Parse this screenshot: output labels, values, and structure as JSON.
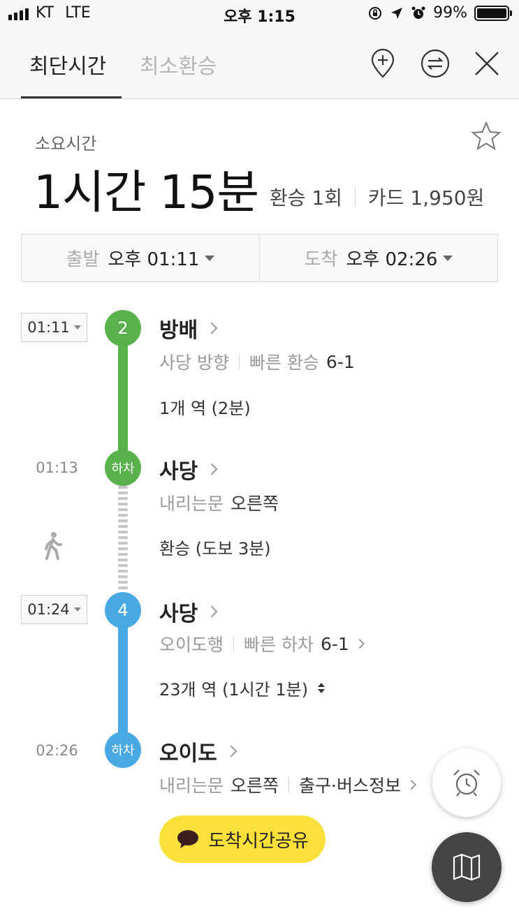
{
  "status_bar": {
    "carrier": "KT",
    "network": "LTE",
    "time": "오후 1:15",
    "battery": "99%",
    "battery_level": 0.99
  },
  "header": {
    "tabs": [
      {
        "label": "최단시간",
        "active": true
      },
      {
        "label": "최소환승",
        "active": false
      }
    ],
    "icons": [
      "add-location-icon",
      "swap-icon",
      "close-icon"
    ]
  },
  "summary": {
    "duration_label": "소요시간",
    "duration": "1시간 15분",
    "transfers": "환승 1회",
    "fare": "카드 1,950원"
  },
  "times": {
    "depart_label": "출발",
    "depart_value": "오후 01:11",
    "arrive_label": "도착",
    "arrive_value": "오후 02:26"
  },
  "route": {
    "seg1": {
      "time": "01:11",
      "line": "2",
      "line_color": "#59b14c",
      "station": "방배",
      "direction": "사당 방향",
      "quick_label": "빠른 환승",
      "quick_value": "6-1",
      "stops": "1개 역 (2분)"
    },
    "alight1": {
      "time": "01:13",
      "badge": "하차",
      "station": "사당",
      "door_label": "내리는문",
      "door_value": "오른쪽"
    },
    "walk": {
      "text": "환승 (도보 3분)"
    },
    "seg2": {
      "time": "01:24",
      "line": "4",
      "line_color": "#48a9e3",
      "station": "사당",
      "direction": "오이도행",
      "quick_label": "빠른 하차",
      "quick_value": "6-1",
      "stops": "23개 역 (1시간 1분)"
    },
    "alight2": {
      "time": "02:26",
      "badge": "하차",
      "station": "오이도",
      "door_label": "내리는문",
      "door_value": "오른쪽",
      "exit_info": "출구·버스정보"
    }
  },
  "share_button": "도착시간공유",
  "fabs": [
    "alarm-clock-icon",
    "map-icon"
  ]
}
